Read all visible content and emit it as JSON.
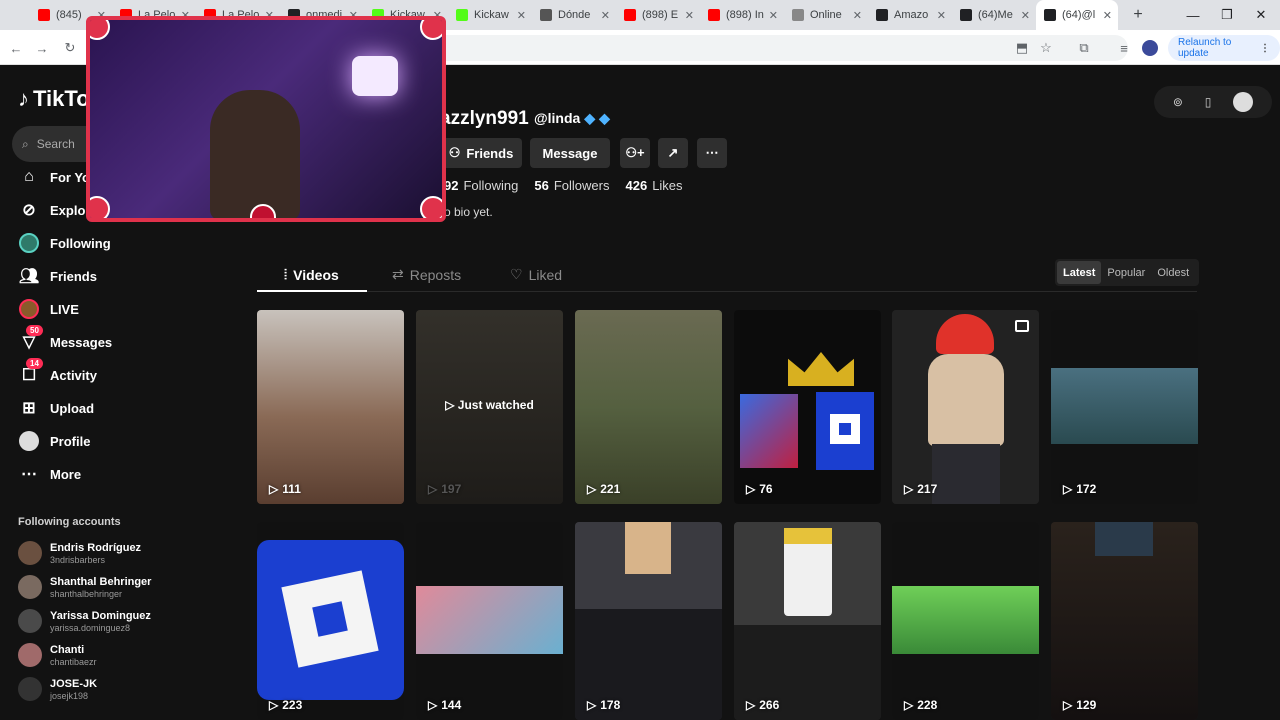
{
  "browser": {
    "tabs": [
      {
        "title": "(845) ",
        "color": "#ff0000"
      },
      {
        "title": "La Pelo",
        "color": "#ff0000"
      },
      {
        "title": "La Pelo",
        "color": "#ff0000"
      },
      {
        "title": "onmedi",
        "color": "#202124"
      },
      {
        "title": "Kickaw",
        "color": "#53fc18"
      },
      {
        "title": "Kickaw",
        "color": "#53fc18"
      },
      {
        "title": "Dónde",
        "color": "#555555"
      },
      {
        "title": "(898) E",
        "color": "#ff0000"
      },
      {
        "title": "(898) In",
        "color": "#ff0000"
      },
      {
        "title": "Online",
        "color": "#888888"
      },
      {
        "title": "Amazo",
        "color": "#202124"
      },
      {
        "title": "(64)Me",
        "color": "#202124"
      },
      {
        "title": "(64)@l",
        "color": "#202124"
      }
    ],
    "relaunch_label": "Relaunch to update",
    "new_tab": "+",
    "minimize": "—",
    "maximize": "❐",
    "close": "✕"
  },
  "sidebar": {
    "logo": "TikTok",
    "search_placeholder": "Search",
    "nav": [
      {
        "label": "For You",
        "icon": "home-icon"
      },
      {
        "label": "Explore",
        "icon": "compass-icon"
      },
      {
        "label": "Following",
        "icon": "following-icon"
      },
      {
        "label": "Friends",
        "icon": "friends-icon"
      },
      {
        "label": "LIVE",
        "icon": "live-icon"
      },
      {
        "label": "Messages",
        "icon": "messages-icon",
        "badge": "50"
      },
      {
        "label": "Activity",
        "icon": "activity-icon",
        "badge": "14"
      },
      {
        "label": "Upload",
        "icon": "upload-icon"
      },
      {
        "label": "Profile",
        "icon": "profile-icon"
      },
      {
        "label": "More",
        "icon": "more-icon"
      }
    ],
    "following_title": "Following accounts",
    "following_accounts": [
      {
        "name": "Endris Rodríguez",
        "handle": "3ndrisbarbers"
      },
      {
        "name": "Shanthal Behringer",
        "handle": "shanthalbehringer"
      },
      {
        "name": "Yarissa Dominguez",
        "handle": "yarissa.dominguez8"
      },
      {
        "name": "Chanti",
        "handle": "chantibaezr"
      },
      {
        "name": "JOSE-JK",
        "handle": "josejk198"
      }
    ]
  },
  "profile": {
    "username": "azzlyn991",
    "handle": "@linda",
    "friends_label": "Friends",
    "message_label": "Message",
    "following_count": "92",
    "following_label": "Following",
    "followers_count": "56",
    "followers_label": "Followers",
    "likes_count": "426",
    "likes_label": "Likes",
    "bio": "o bio yet."
  },
  "tabs": {
    "videos": "Videos",
    "reposts": "Reposts",
    "liked": "Liked"
  },
  "sort": {
    "latest": "Latest",
    "popular": "Popular",
    "oldest": "Oldest"
  },
  "videos": [
    {
      "views": "111",
      "color": "#7a5a46"
    },
    {
      "views": "197",
      "color": "#2a2824",
      "just_watched": "Just watched"
    },
    {
      "views": "221",
      "color": "#4f5a3a"
    },
    {
      "views": "76",
      "color": "#0c0c0c"
    },
    {
      "views": "217",
      "color": "#222222"
    },
    {
      "views": "172",
      "color": "#111111"
    },
    {
      "views": "223",
      "color": "#1b3fd0"
    },
    {
      "views": "144",
      "color": "#111111"
    },
    {
      "views": "178",
      "color": "#2e2e33"
    },
    {
      "views": "266",
      "color": "#2b2b2b"
    },
    {
      "views": "228",
      "color": "#111111"
    },
    {
      "views": "129",
      "color": "#1a1410"
    }
  ]
}
